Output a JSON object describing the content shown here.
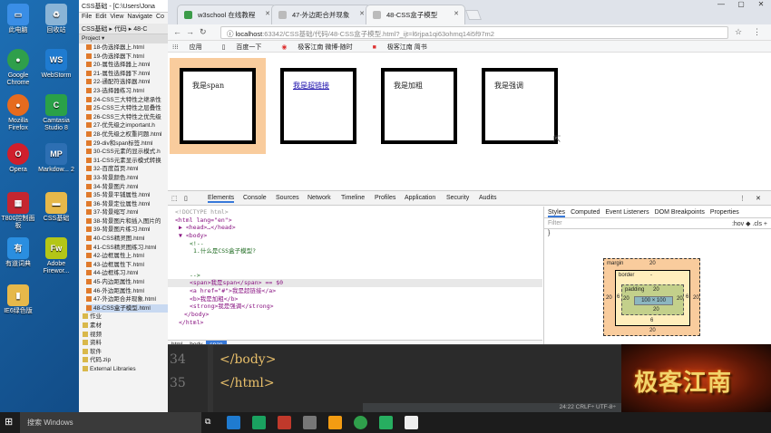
{
  "desktop": {
    "icons": [
      {
        "label": "此电脑",
        "icon": "computer-icon",
        "color": "#3a8ee6"
      },
      {
        "label": "回收站",
        "icon": "recycle-bin-icon",
        "color": "#8ab4d6"
      },
      {
        "label": "Google Chrome",
        "icon": "chrome-icon",
        "color": "#2f9f4b"
      },
      {
        "label": "WebStorm",
        "icon": "webstorm-icon",
        "color": "#1f7bd0"
      },
      {
        "label": "Mozilla Firefox",
        "icon": "firefox-icon",
        "color": "#e66b1e"
      },
      {
        "label": "Camtasia Studio 8",
        "icon": "camtasia-icon",
        "color": "#2aa148"
      },
      {
        "label": "Opera",
        "icon": "opera-icon",
        "color": "#d01f2c"
      },
      {
        "label": "Markdow... 2",
        "icon": "markdown-icon",
        "color": "#2d6fb3"
      },
      {
        "label": "T800控制面板",
        "icon": "control-panel-icon",
        "color": "#c52630"
      },
      {
        "label": "CSS基础",
        "icon": "folder-icon",
        "color": "#e6b84a"
      },
      {
        "label": "有道词典",
        "icon": "youdao-icon",
        "color": "#2a8ee0"
      },
      {
        "label": "Adobe Firewor...",
        "icon": "fireworks-icon",
        "color": "#b4c617"
      },
      {
        "label": "IE6绿色版",
        "icon": "ie-icon",
        "color": "#e6b84a"
      }
    ]
  },
  "ide": {
    "title": "CSS基础 - [C:\\Users\\Jona",
    "menu": [
      "File",
      "Edit",
      "View",
      "Navigate",
      "Co"
    ],
    "breadcrumb": [
      "CSS基础",
      "代码",
      "48-C"
    ],
    "project_label": "Project",
    "tree": [
      "18-伪选择器上.html",
      "19-伪选择器下.html",
      "20-属性选择器上.html",
      "21-属性选择器下.html",
      "22-通配符选择器.html",
      "23-选择器练习.html",
      "24-CSS三大特性之继承性",
      "25-CSS三大特性之层叠性",
      "26-CSS三大特性之优先级",
      "27-优先级之important.h",
      "28-优先级之权重问题.html",
      "29-div和span标签.html",
      "30-CSS元素的显示模式.h",
      "31-CSS元素显示模式转换",
      "32-百度首页.html",
      "33-背景颜色.html",
      "34-背景图片.html",
      "35-背景平铺属性.html",
      "36-背景定位属性.html",
      "37-背景缩写.html",
      "38-背景图片和插入图片的",
      "39-背景图片练习.html",
      "40-CSS精灵图.html",
      "41-CSS精灵图练习.html",
      "42-边框属性上.html",
      "43-边框属性下.html",
      "44-边框练习.html",
      "45-内边距属性.html",
      "46-外边距属性.html",
      "47-外边距合并现象.html",
      "48-CSS盒子模型.html"
    ],
    "folders": [
      "作业",
      "素材",
      "视频",
      "资料",
      "软件",
      "代码.zip",
      "External Libraries"
    ]
  },
  "browser": {
    "tabs": [
      {
        "title": "w3school 在线教程",
        "color": "#3b9b49"
      },
      {
        "title": "47-外边距合并现象",
        "color": "#999999"
      },
      {
        "title": "48-CSS盒子模型",
        "color": "#999999"
      }
    ],
    "url_host": "localhost",
    "url_rest": ":63342/CSS基础/代码/48-CSS盒子模型.html?_ijt=l6rjpa1qi63ohmq14i5f97m2",
    "bookmarks": [
      "应用",
      "百度一下",
      "极客江南 微博-随时",
      "极客江南 简书"
    ],
    "boxes": [
      "我是span",
      "我是超链接",
      "我是加粗",
      "我是强调"
    ],
    "margin_color": "#f9cc9d"
  },
  "devtools": {
    "tabs": [
      "Elements",
      "Console",
      "Sources",
      "Network",
      "Timeline",
      "Profiles",
      "Application",
      "Security",
      "Audits"
    ],
    "dom": [
      "<!DOCTYPE html>",
      "<html lang=\"en\">",
      "▶ <head>…</head>",
      "▼ <body>",
      "<!--",
      "1.什么是CSS盒子模型?",
      "",
      "",
      "-->",
      "<span>我是span</span> == $0",
      "<a href=\"#\">我是超链接</a>",
      "<b>我是加粗</b>",
      "<strong>我是强调</strong>",
      "</body>",
      "</html>"
    ],
    "crumbs": [
      "html",
      "body",
      "span"
    ],
    "styles_tabs": [
      "Styles",
      "Computed",
      "Event Listeners",
      "DOM Breakpoints",
      "Properties"
    ],
    "filter_placeholder": "Filter",
    "filter_right": ":hov  ◆  .cls  +",
    "brace": "}",
    "box_model": {
      "margin_label": "margin",
      "margin": "20",
      "border_label": "border",
      "border": "6",
      "padding_label": "padding",
      "padding": "20",
      "content": "100 × 100",
      "dash": "-"
    }
  },
  "editor": {
    "lines": [
      {
        "num": "34",
        "code": "</body>"
      },
      {
        "num": "35",
        "code": "</html>"
      }
    ],
    "status": "24:22  CRLF÷  UTF-8÷"
  },
  "logo_text": "极客江南",
  "taskbar": {
    "search_placeholder": "搜索 Windows"
  }
}
